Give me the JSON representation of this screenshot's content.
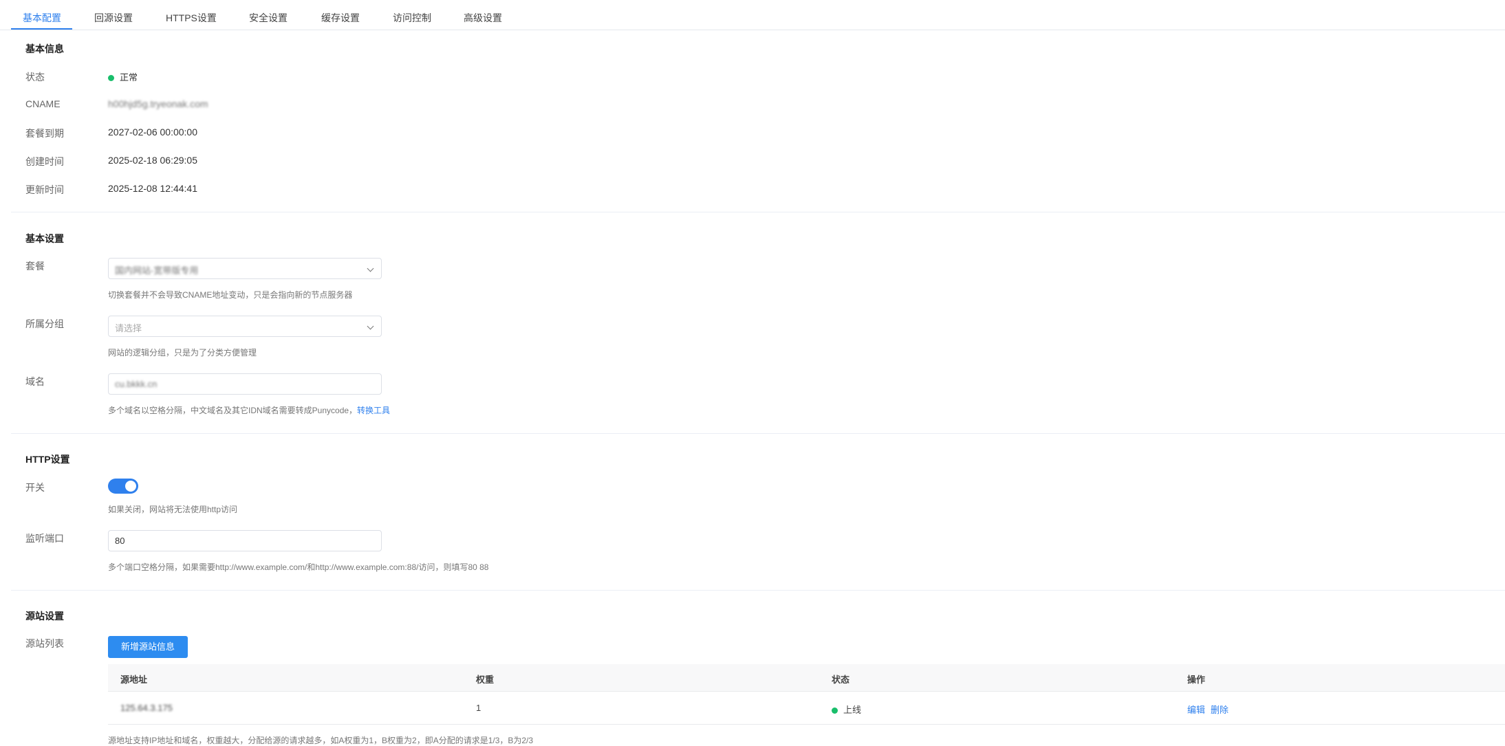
{
  "tabs": [
    "基本配置",
    "回源设置",
    "HTTPS设置",
    "安全设置",
    "缓存设置",
    "访问控制",
    "高级设置"
  ],
  "basic_info": {
    "title": "基本信息",
    "status_label": "状态",
    "status_value": "正常",
    "cname_label": "CNAME",
    "cname_value": "h00hjd5g.tryeonak.com",
    "expire_label": "套餐到期",
    "expire_value": "2027-02-06 00:00:00",
    "created_label": "创建时间",
    "created_value": "2025-02-18 06:29:05",
    "updated_label": "更新时间",
    "updated_value": "2025-12-08 12:44:41"
  },
  "basic_settings": {
    "title": "基本设置",
    "package_label": "套餐",
    "package_value": "国内网站-宽带版专用",
    "package_hint": "切换套餐并不会导致CNAME地址变动，只是会指向新的节点服务器",
    "group_label": "所属分组",
    "group_placeholder": "请选择",
    "group_hint": "网站的逻辑分组，只是为了分类方便管理",
    "domain_label": "域名",
    "domain_value": "cu.bkkk.cn",
    "domain_hint": "多个域名以空格分隔，中文域名及其它IDN域名需要转成Punycode，",
    "domain_hint_link": "转换工具"
  },
  "http_settings": {
    "title": "HTTP设置",
    "switch_label": "开关",
    "switch_on": true,
    "switch_hint": "如果关闭，网站将无法使用http访问",
    "port_label": "监听端口",
    "port_value": "80",
    "port_hint": "多个端口空格分隔，如果需要http://www.example.com/和http://www.example.com:88/访问，则填写80 88"
  },
  "origin_settings": {
    "title": "源站设置",
    "list_label": "源站列表",
    "add_button": "新增源站信息",
    "columns": [
      "源地址",
      "权重",
      "状态",
      "操作"
    ],
    "rows": [
      {
        "address": "125.64.3.175",
        "weight": "1",
        "status": "上线",
        "actions": [
          "编辑",
          "删除"
        ]
      }
    ],
    "footer_hint": "源地址支持IP地址和域名，权重越大，分配给源的请求越多，如A权重为1，B权重为2，即A分配的请求是1/3，B为2/3"
  },
  "colors": {
    "accent": "#2f80ed",
    "status_ok": "#19be6b"
  }
}
